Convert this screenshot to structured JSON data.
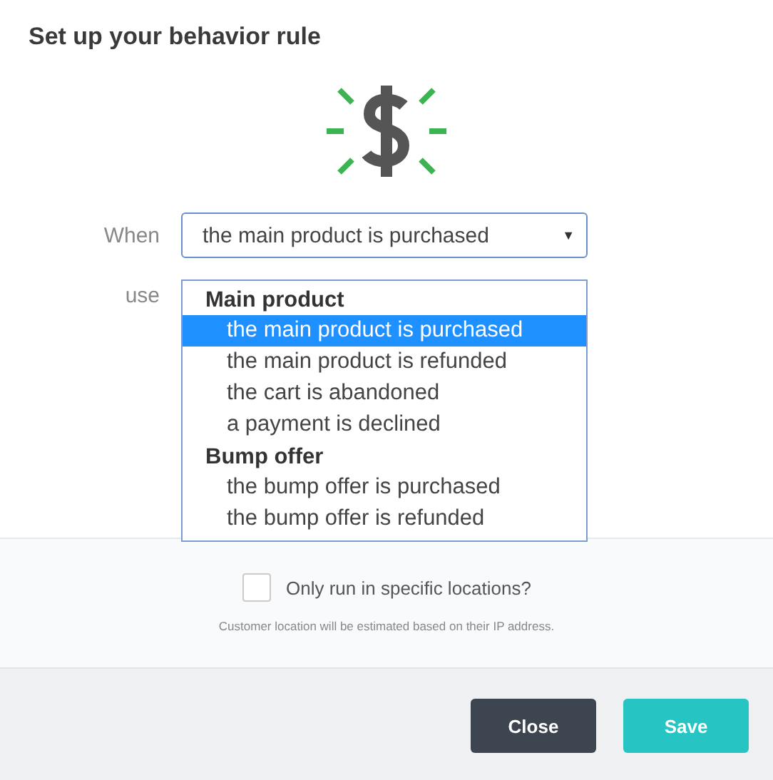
{
  "title": "Set up your behavior rule",
  "when": {
    "label": "When",
    "value": "the main product is purchased",
    "caret": "▼"
  },
  "use": {
    "label": "use"
  },
  "dropdown": {
    "groups": [
      {
        "label": "Main product",
        "options": [
          {
            "label": "the main product is purchased",
            "selected": true
          },
          {
            "label": "the main product is refunded",
            "selected": false
          },
          {
            "label": "the cart is abandoned",
            "selected": false
          },
          {
            "label": "a payment is declined",
            "selected": false
          }
        ]
      },
      {
        "label": "Bump offer",
        "options": [
          {
            "label": "the bump offer is purchased",
            "selected": false
          },
          {
            "label": "the bump offer is refunded",
            "selected": false
          }
        ]
      }
    ]
  },
  "location": {
    "label": "Only run in specific locations?",
    "checked": false,
    "note": "Customer location will be estimated based on their IP address."
  },
  "buttons": [
    {
      "label": "Close",
      "kind": "secondary"
    },
    {
      "label": "Save",
      "kind": "primary"
    }
  ]
}
